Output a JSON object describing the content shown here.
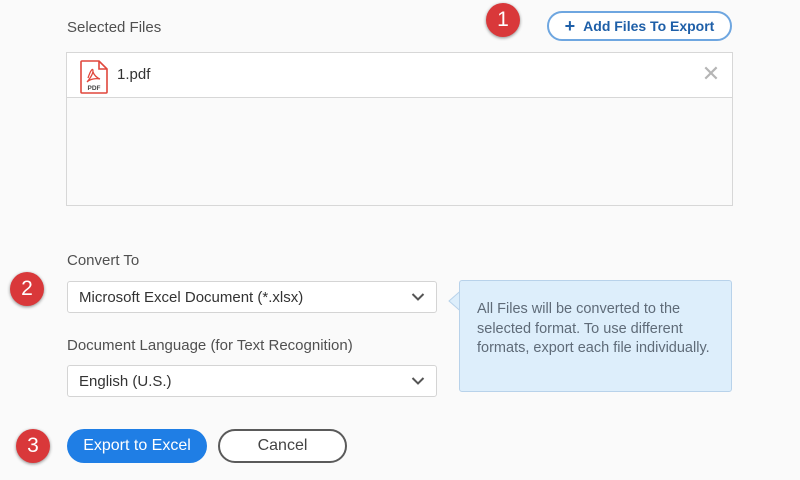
{
  "selected_files": {
    "label": "Selected Files",
    "add_button": {
      "icon": "plus-icon",
      "plus_glyph": "+",
      "label": "Add Files To Export"
    },
    "files": [
      {
        "name": "1.pdf",
        "icon": "pdf-file-icon",
        "icon_text": "PDF",
        "remove_icon": "close-icon",
        "remove_glyph": "✕"
      }
    ]
  },
  "convert_to": {
    "label": "Convert To",
    "selected": "Microsoft Excel Document (*.xlsx)"
  },
  "document_language": {
    "label": "Document Language (for Text Recognition)",
    "selected": "English (U.S.)"
  },
  "info_callout": {
    "text": "All Files will be converted to the selected format. To use different formats, export each file individually."
  },
  "actions": {
    "primary_label": "Export to Excel",
    "cancel_label": "Cancel"
  },
  "step_badges": [
    "1",
    "2",
    "3"
  ],
  "colors": {
    "accent_blue": "#1f7ee5",
    "badge_red": "#d9383a",
    "callout_bg": "#ddeefb",
    "link_blue": "#1e5fa8"
  }
}
